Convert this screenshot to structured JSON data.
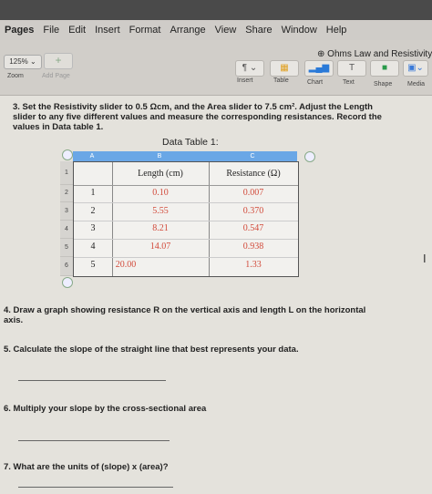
{
  "menu": [
    "Pages",
    "File",
    "Edit",
    "Insert",
    "Format",
    "Arrange",
    "View",
    "Share",
    "Window",
    "Help"
  ],
  "toolbar": {
    "zoom": "125%",
    "zoom_label": "Zoom",
    "add_page_label": "Add Page",
    "document_title": "Ohms Law and Resistivity",
    "tools": [
      "Insert",
      "Table",
      "Chart",
      "Text",
      "Shape",
      "Media"
    ]
  },
  "questions": {
    "q3": "3. Set the Resistivity slider to 0.5 Ωcm, and the Area slider to 7.5 cm². Adjust the Length slider to any five different values and measure the corresponding resistances. Record the values in Data table 1.",
    "q4": "4. Draw a graph showing resistance R on the vertical axis and length L on the horizontal axis.",
    "q5": "5. Calculate the slope of the straight line that best represents your data.",
    "q6": "6. Multiply your slope by the cross-sectional area",
    "q7": "7. What are the units of (slope) x (area)?"
  },
  "table": {
    "title": "Data Table 1:",
    "col_letters": [
      "A",
      "B",
      "C"
    ],
    "row_numbers": [
      "1",
      "2",
      "3",
      "4",
      "5",
      "6"
    ],
    "headers": [
      "",
      "Length (cm)",
      "Resistance (Ω)"
    ],
    "rows": [
      [
        "1",
        "0.10",
        "0.007"
      ],
      [
        "2",
        "5.55",
        "0.370"
      ],
      [
        "3",
        "8.21",
        "0.547"
      ],
      [
        "4",
        "14.07",
        "0.938"
      ],
      [
        "5",
        "20.00",
        "1.33"
      ]
    ]
  }
}
